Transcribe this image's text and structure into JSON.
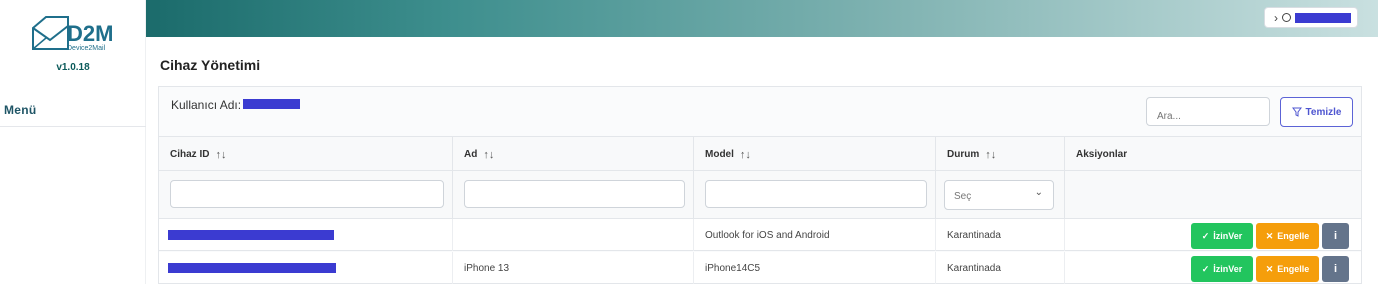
{
  "app": {
    "logo_text": "D2M",
    "logo_subtext": "Device2Mail",
    "version": "v1.0.18",
    "menu_title": "Menü"
  },
  "page": {
    "title": "Cihaz Yönetimi"
  },
  "toolbar": {
    "user_label": "Kullanıcı Adı:",
    "search_placeholder": "Ara...",
    "clear_label": "Temizle"
  },
  "table": {
    "columns": [
      {
        "label": "Cihaz ID",
        "sortable": true
      },
      {
        "label": "Ad",
        "sortable": true
      },
      {
        "label": "Model",
        "sortable": true
      },
      {
        "label": "Durum",
        "sortable": true
      },
      {
        "label": "Aksiyonlar",
        "sortable": false
      }
    ],
    "sort_glyph": "↑↓",
    "status_filter_placeholder": "Seç",
    "rows": [
      {
        "ad": "",
        "model": "Outlook for iOS and Android",
        "durum": "Karantinada"
      },
      {
        "ad": "iPhone 13",
        "model": "iPhone14C5",
        "durum": "Karantinada"
      }
    ],
    "actions": {
      "allow_label": "İzinVer",
      "block_label": "Engelle",
      "info_label": "i"
    }
  },
  "colors": {
    "accent": "#4e55d0",
    "allow": "#22c55e",
    "block": "#f59e0b",
    "info": "#64748b",
    "redaction": "#3b3bd1"
  }
}
